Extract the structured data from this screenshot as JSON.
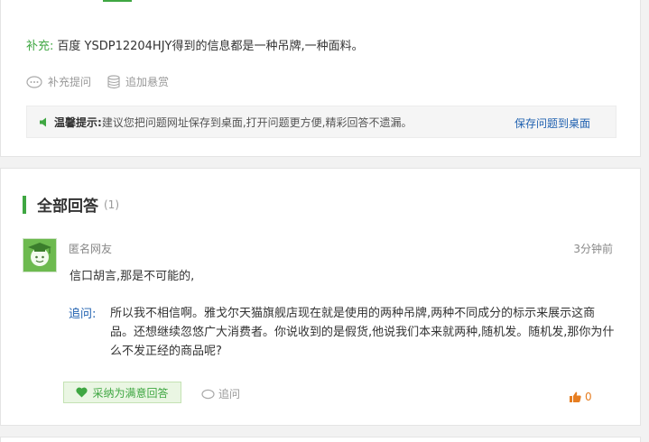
{
  "question": {
    "supplement_label": "补充:",
    "supplement_text": "百度 YSDP12204HJY得到的信息都是一种吊牌,一种面料。",
    "actions": {
      "add_question_label": "补充提问",
      "add_reward_label": "追加悬赏"
    },
    "tip": {
      "title": "温馨提示:",
      "text": "建议您把问题网址保存到桌面,打开问题更方便,精彩回答不遗漏。",
      "link_label": "保存问题到桌面"
    }
  },
  "answers": {
    "heading": "全部回答",
    "count": "(1)",
    "items": [
      {
        "user": "匿名网友",
        "time": "3分钟前",
        "text": "信口胡言,那是不可能的,",
        "followup_label": "追问:",
        "followup_text": "所以我不相信啊。雅戈尔天猫旗舰店现在就是使用的两种吊牌,两种不同成分的标示来展示这商品。还想继续忽悠广大消费者。你说收到的是假货,他说我们本来就两种,随机发。随机发,那你为什么不发正经的商品呢?",
        "accept_label": "采纳为满意回答",
        "ask_label": "追问",
        "likes": "0"
      }
    ]
  },
  "colors": {
    "accent_green": "#3fa742",
    "link_blue": "#2061b0",
    "like_orange": "#e67e22"
  },
  "icons": {
    "add_question": "speech-bubble-icon",
    "add_reward": "coin-stack-icon",
    "tip": "speaker-icon",
    "avatar": "graduate-avatar-icon",
    "accept": "heart-icon",
    "ask": "speech-bubble-icon",
    "like": "thumbs-up-icon"
  }
}
